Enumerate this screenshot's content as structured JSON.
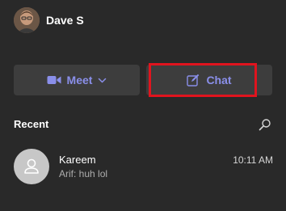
{
  "user": {
    "name": "Dave S"
  },
  "actions": {
    "meet_label": "Meet",
    "chat_label": "Chat"
  },
  "recent": {
    "title": "Recent",
    "items": [
      {
        "name": "Kareem",
        "preview": "Arif: huh lol",
        "time": "10:11 AM"
      }
    ]
  },
  "colors": {
    "background": "#292929",
    "button_bg": "#3d3d3d",
    "accent": "#8a8fea",
    "highlight": "#e0141e",
    "contact_avatar_bg": "#c7c7c7"
  },
  "icons": {
    "meet": "video-camera-icon",
    "meet_dropdown": "chevron-down-icon",
    "chat": "compose-icon",
    "search": "search-icon",
    "contact": "person-icon"
  }
}
